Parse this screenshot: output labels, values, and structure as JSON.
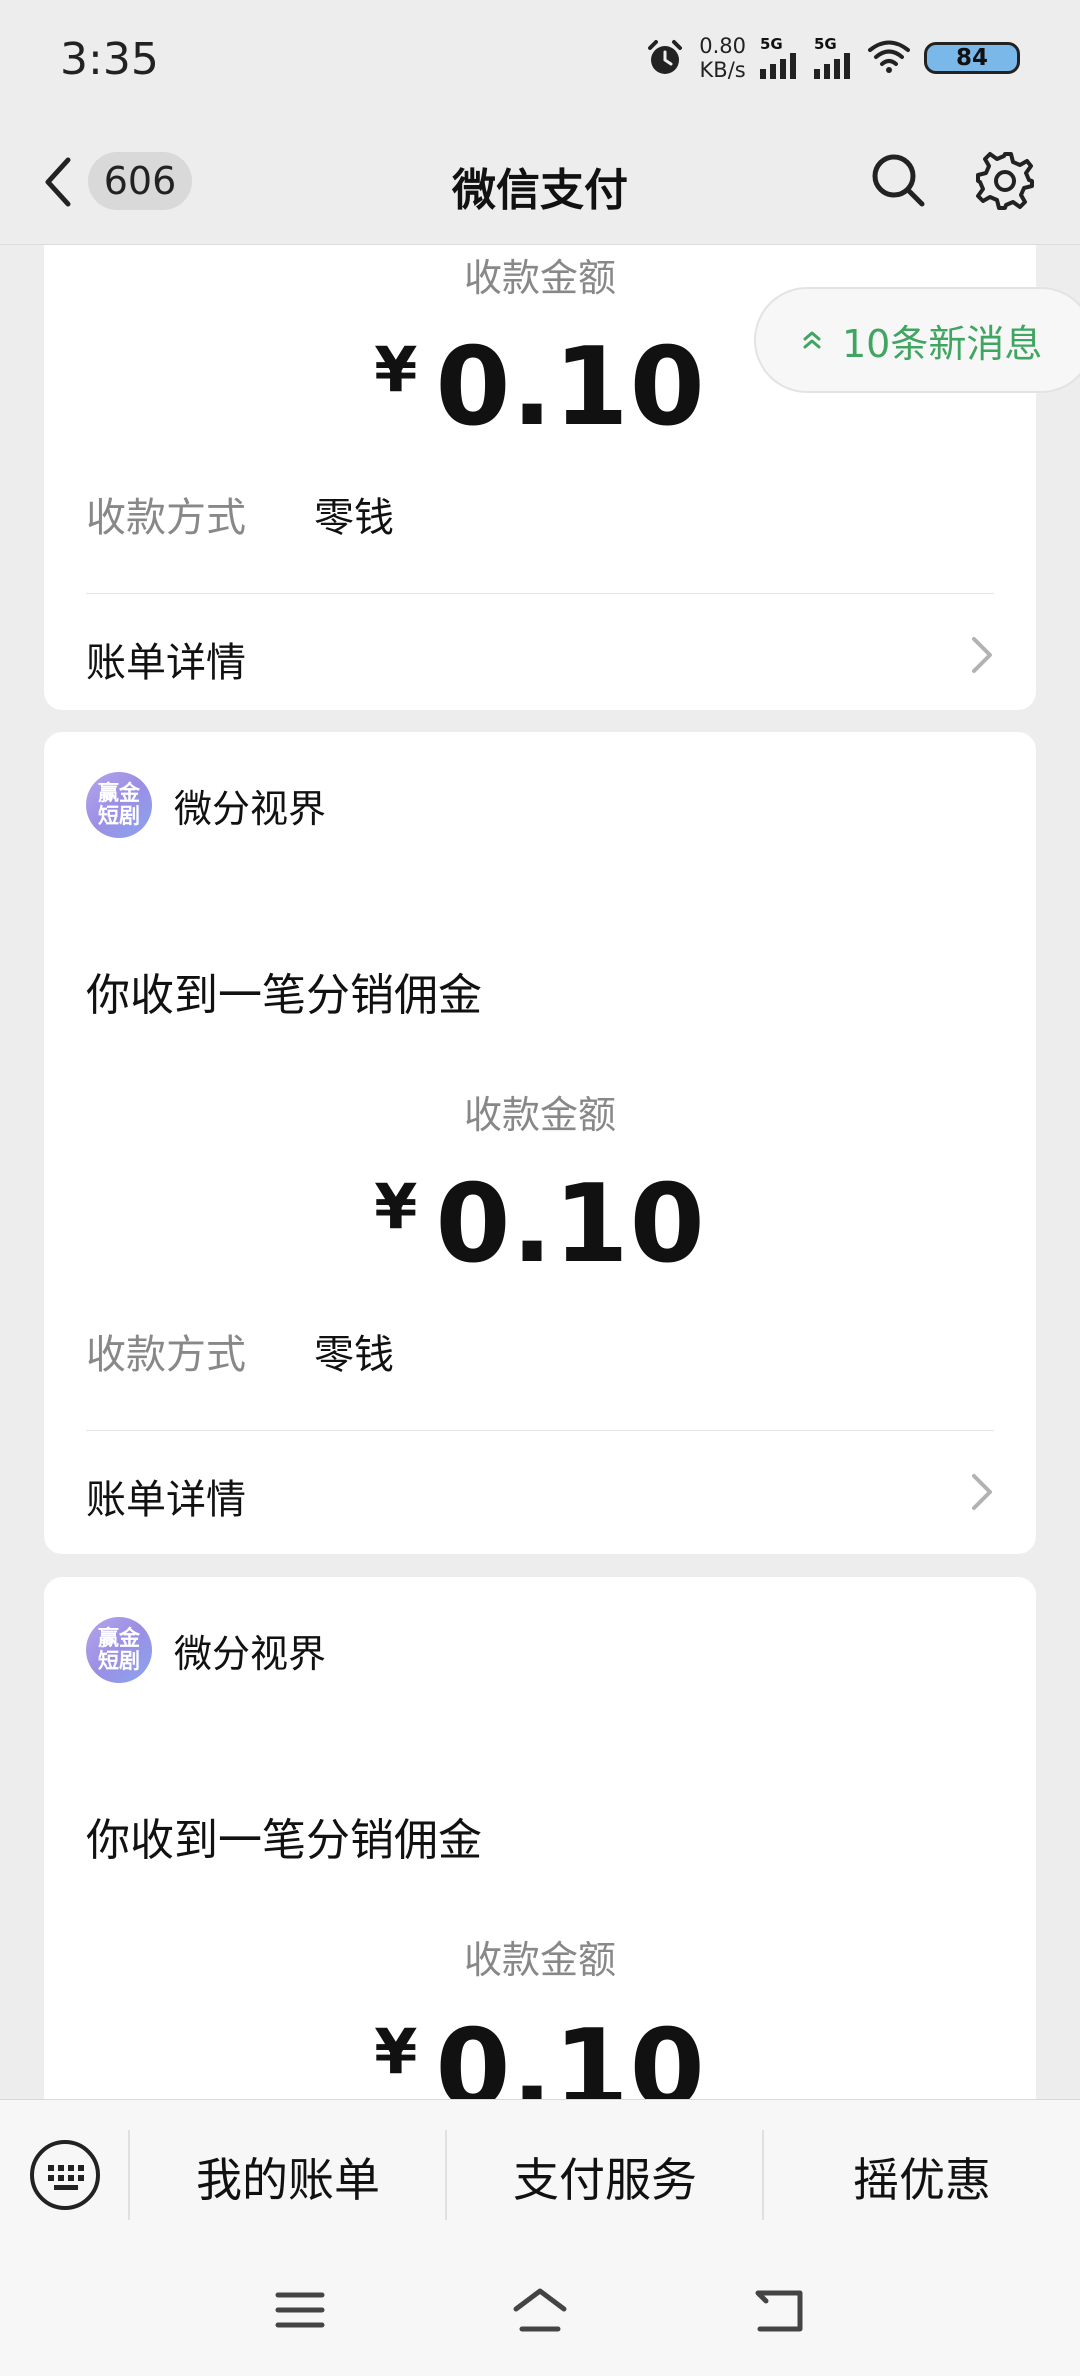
{
  "status_bar": {
    "time": "3:35",
    "net_speed_value": "0.80",
    "net_speed_unit": "KB/s",
    "sim1": "5G",
    "sim2": "5G",
    "battery": "84"
  },
  "nav": {
    "unread_count": "606",
    "title": "微信支付"
  },
  "new_messages": {
    "label": "10条新消息",
    "color": "#3fa560"
  },
  "cards": [
    {
      "amount_label": "收款金额",
      "currency": "¥",
      "amount": "0.10",
      "method_label": "收款方式",
      "method_value": "零钱",
      "detail_label": "账单详情"
    },
    {
      "app_logo_line1": "赢金",
      "app_logo_line2": "短剧",
      "app_name": "微分视界",
      "subtitle": "你收到一笔分销佣金",
      "amount_label": "收款金额",
      "currency": "¥",
      "amount": "0.10",
      "method_label": "收款方式",
      "method_value": "零钱",
      "detail_label": "账单详情"
    },
    {
      "app_logo_line1": "赢金",
      "app_logo_line2": "短剧",
      "app_name": "微分视界",
      "subtitle": "你收到一笔分销佣金",
      "amount_label": "收款金额",
      "currency": "¥",
      "amount": "0.10"
    }
  ],
  "bottom_menu": {
    "items": [
      "我的账单",
      "支付服务",
      "摇优惠"
    ]
  },
  "icons": {
    "back": "chevron-left-icon",
    "search": "search-icon",
    "settings": "gear-icon",
    "keyboard": "keyboard-icon",
    "menu": "menu-icon",
    "home": "home-icon",
    "return": "return-icon"
  }
}
